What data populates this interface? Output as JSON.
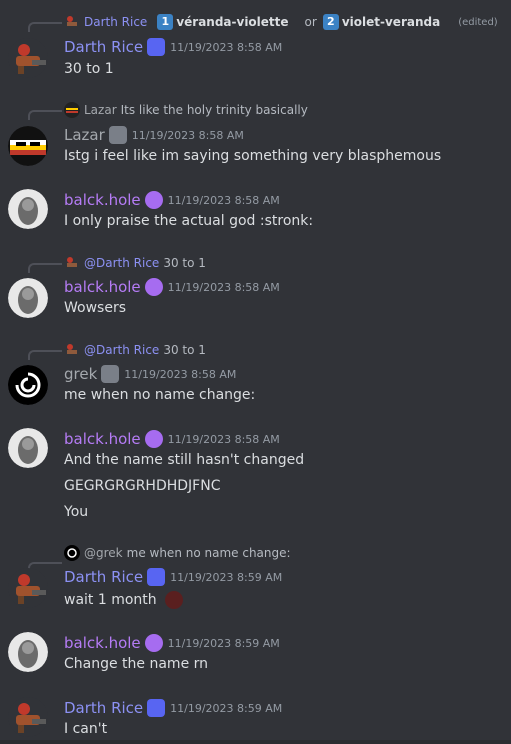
{
  "colors": {
    "darth": "#8c91f3",
    "lazar": "#a4a8ad",
    "balck": "#b57cf5",
    "grek": "#a4a8ad",
    "background": "#313338"
  },
  "messages": [
    {
      "reply": {
        "author": "Darth Rice",
        "option1_num": "1",
        "option1": "véranda-violette",
        "or": "or",
        "option2_num": "2",
        "option2": "violet-veranda",
        "edited": "(edited)"
      },
      "author": "Darth Rice",
      "timestamp": "11/19/2023 8:58 AM",
      "lines": [
        "30 to 1"
      ]
    },
    {
      "reply": {
        "author": "Lazar",
        "text": "Its like the holy trinity basically"
      },
      "author": "Lazar",
      "timestamp": "11/19/2023 8:58 AM",
      "lines": [
        "Istg i feel like im saying something very blasphemous"
      ]
    },
    {
      "author": "balck.hole",
      "timestamp": "11/19/2023 8:58 AM",
      "lines": [
        "I only praise the actual god :stronk:"
      ]
    },
    {
      "reply": {
        "author": "@Darth Rice",
        "text": "30 to 1"
      },
      "author": "balck.hole",
      "timestamp": "11/19/2023 8:58 AM",
      "lines": [
        "Wowsers"
      ]
    },
    {
      "reply": {
        "author": "@Darth Rice",
        "text": "30 to 1"
      },
      "author": "grek",
      "timestamp": "11/19/2023 8:58 AM",
      "lines": [
        "me when no name change:"
      ]
    },
    {
      "author": "balck.hole",
      "timestamp": "11/19/2023 8:58 AM",
      "lines": [
        "And the name still hasn't changed",
        "GEGRGRGRHDHDJFNC",
        "You"
      ]
    },
    {
      "reply": {
        "author": "@grek",
        "text": "me when no name change:"
      },
      "author": "Darth Rice",
      "timestamp": "11/19/2023 8:59 AM",
      "lines": [
        "wait 1 month"
      ]
    },
    {
      "author": "balck.hole",
      "timestamp": "11/19/2023 8:59 AM",
      "lines": [
        "Change the name rn"
      ]
    },
    {
      "author": "Darth Rice",
      "timestamp": "11/19/2023 8:59 AM",
      "lines": [
        "I can't"
      ]
    }
  ]
}
